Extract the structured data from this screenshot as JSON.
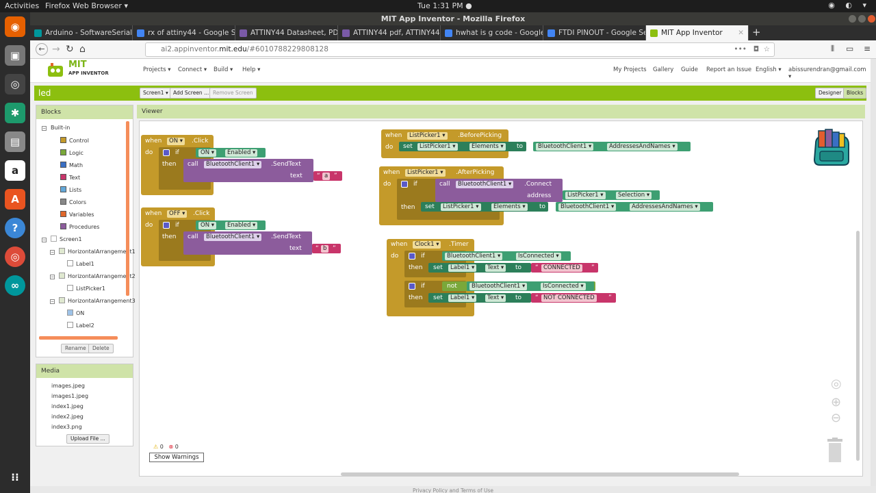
{
  "os": {
    "activities": "Activities",
    "app_menu": "Firefox Web Browser ▾",
    "clock": "Tue  1:31 PM ●",
    "window_title": "MIT App Inventor - Mozilla Firefox"
  },
  "browser": {
    "tabs": [
      {
        "label": "Arduino - SoftwareSerial",
        "color": "#00979c"
      },
      {
        "label": "rx of attiny44 - Google Se",
        "color": "#4285f4"
      },
      {
        "label": "ATTINY44 Datasheet, PD",
        "color": "#7a5aa8"
      },
      {
        "label": "ATTINY44 pdf, ATTINY44",
        "color": "#7a5aa8"
      },
      {
        "label": "hwhat is g code - Google",
        "color": "#4285f4"
      },
      {
        "label": "FTDI PINOUT - Google Se",
        "color": "#4285f4"
      },
      {
        "label": "MIT App Inventor",
        "color": "#8cbf0f"
      }
    ],
    "url_prefix": "ai2.appinventor.",
    "url_domain": "mit.edu",
    "url_path": "/#6010788229808128",
    "url_more": "•••"
  },
  "app": {
    "logo_line1": "MIT",
    "logo_line2": "APP INVENTOR",
    "menus": [
      "Projects ▾",
      "Connect ▾",
      "Build ▾",
      "Help ▾"
    ],
    "right_links": [
      "My Projects",
      "Gallery",
      "Guide",
      "Report an Issue",
      "English ▾",
      "abissurendran@gmail.com ▾"
    ],
    "project_name": "led",
    "screen_button": "Screen1 ▾",
    "add_screen": "Add Screen ...",
    "remove_screen": "Remove Screen",
    "designer": "Designer",
    "blocks_btn": "Blocks",
    "accent": "#8cbf0f"
  },
  "blocks_panel": {
    "title": "Blocks",
    "builtin": "Built-in",
    "builtins": [
      {
        "label": "Control",
        "color": "#c49a2a"
      },
      {
        "label": "Logic",
        "color": "#7aa83a"
      },
      {
        "label": "Math",
        "color": "#3a6fc4"
      },
      {
        "label": "Text",
        "color": "#c8356a"
      },
      {
        "label": "Lists",
        "color": "#63a8d8"
      },
      {
        "label": "Colors",
        "color": "#888888"
      },
      {
        "label": "Variables",
        "color": "#e0672a"
      },
      {
        "label": "Procedures",
        "color": "#8c5c9c"
      }
    ],
    "screen": "Screen1",
    "components": [
      {
        "label": "HorizontalArrangement1",
        "level": 1
      },
      {
        "label": "Label1",
        "level": 2
      },
      {
        "label": "HorizontalArrangement2",
        "level": 1
      },
      {
        "label": "ListPicker1",
        "level": 2
      },
      {
        "label": "HorizontalArrangement3",
        "level": 1
      },
      {
        "label": "ON",
        "level": 2
      },
      {
        "label": "Label2",
        "level": 2
      }
    ],
    "rename": "Rename",
    "delete": "Delete"
  },
  "media": {
    "title": "Media",
    "files": [
      "images.jpeg",
      "images1.jpeg",
      "index1.jpeg",
      "index2.jpeg",
      "index3.png"
    ],
    "upload": "Upload File ..."
  },
  "viewer": {
    "title": "Viewer",
    "warnings_count": "0",
    "errors_count": "0",
    "show_warnings": "Show Warnings"
  },
  "kw": {
    "when": "when",
    "do": "do",
    "if": "if",
    "then": "then",
    "call": "call",
    "set": "set",
    "to": "to",
    "text": "text",
    "address": "address",
    "not": "not"
  },
  "code": {
    "on_btn": "ON ▾",
    "off_btn": "OFF ▾",
    "click": ".Click",
    "enabled": "Enabled ▾",
    "bt": "BluetoothClient1 ▾",
    "send_text": ".SendText",
    "str_a": "a",
    "str_b": "b",
    "lp": "ListPicker1 ▾",
    "before_picking": ".BeforePicking",
    "after_picking": ".AfterPicking",
    "elements": "Elements ▾",
    "addresses": "AddressesAndNames ▾",
    "connect": ".Connect",
    "selection": "Selection ▾",
    "clock": "Clock1 ▾",
    "timer": ".Timer",
    "is_connected": "IsConnected ▾",
    "label1": "Label1 ▾",
    "text_prop": "Text ▾",
    "connected": "CONNECTED",
    "not_connected": "NOT CONNECTED"
  },
  "footer": "Privacy Policy and Terms of Use"
}
